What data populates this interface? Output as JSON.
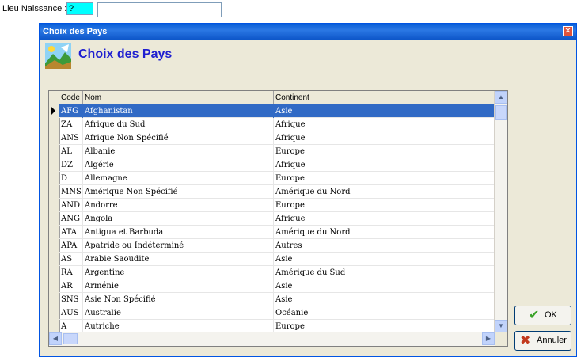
{
  "top_field": {
    "label": "Lieu Naissance :",
    "code_value": "?",
    "name_value": ""
  },
  "dialog": {
    "title": "Choix des Pays",
    "header": "Choix des Pays",
    "close_glyph": "✕"
  },
  "grid": {
    "columns": [
      "Code",
      "Nom",
      "Continent"
    ],
    "rows": [
      {
        "code": "AFG",
        "nom": "Afghanistan",
        "continent": "Asie"
      },
      {
        "code": "ZA",
        "nom": "Afrique du Sud",
        "continent": "Afrique"
      },
      {
        "code": "ANS",
        "nom": "Afrique Non Spécifié",
        "continent": "Afrique"
      },
      {
        "code": "AL",
        "nom": "Albanie",
        "continent": "Europe"
      },
      {
        "code": "DZ",
        "nom": "Algérie",
        "continent": "Afrique"
      },
      {
        "code": "D",
        "nom": "Allemagne",
        "continent": "Europe"
      },
      {
        "code": "MNS",
        "nom": "Amérique Non Spécifié",
        "continent": "Amérique du Nord"
      },
      {
        "code": "AND",
        "nom": "Andorre",
        "continent": "Europe"
      },
      {
        "code": "ANG",
        "nom": "Angola",
        "continent": "Afrique"
      },
      {
        "code": "ATA",
        "nom": "Antigua et Barbuda",
        "continent": "Amérique du Nord"
      },
      {
        "code": "APA",
        "nom": "Apatride ou Indéterminé",
        "continent": "Autres"
      },
      {
        "code": "AS",
        "nom": "Arabie Saoudite",
        "continent": "Asie"
      },
      {
        "code": "RA",
        "nom": "Argentine",
        "continent": "Amérique du Sud"
      },
      {
        "code": "AR",
        "nom": "Arménie",
        "continent": "Asie"
      },
      {
        "code": "SNS",
        "nom": "Asie Non Spécifié",
        "continent": "Asie"
      },
      {
        "code": "AUS",
        "nom": "Australie",
        "continent": "Océanie"
      },
      {
        "code": "A",
        "nom": "Autriche",
        "continent": "Europe"
      }
    ],
    "selected_index": 0
  },
  "buttons": {
    "ok_label": "OK",
    "cancel_label": "Annuler"
  }
}
